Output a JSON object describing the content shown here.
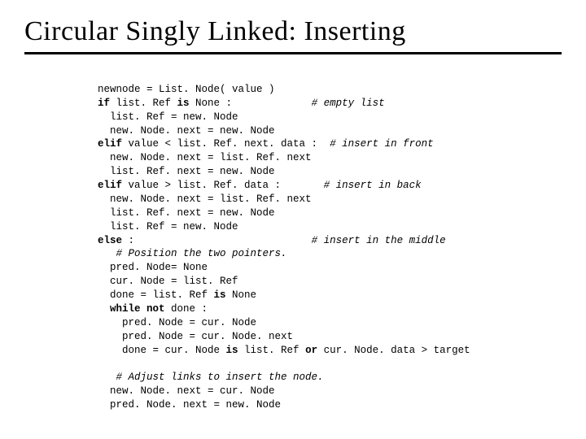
{
  "title": "Circular Singly Linked: Inserting",
  "code": {
    "l01a": "newnode = List. Node( value )",
    "l02a": "if",
    "l02b": " list. Ref ",
    "l02c": "is",
    "l02d": " None :             ",
    "l02e": "# empty list",
    "l03a": "  list. Ref = new. Node",
    "l04a": "  new. Node. next = new. Node",
    "l05a": "elif",
    "l05b": " value < list. Ref. next. data :  ",
    "l05c": "# insert in front",
    "l06a": "  new. Node. next = list. Ref. next",
    "l07a": "  list. Ref. next = new. Node",
    "l08a": "elif",
    "l08b": " value > list. Ref. data :       ",
    "l08c": "# insert in back",
    "l09a": "  new. Node. next = list. Ref. next",
    "l10a": "  list. Ref. next = new. Node",
    "l11a": "  list. Ref = new. Node",
    "l12a": "else",
    "l12b": " :                             ",
    "l12c": "# insert in the middle",
    "l13a": "   # Position the two pointers.",
    "l14a": "  pred. Node= None",
    "l15a": "  cur. Node = list. Ref",
    "l16a": "  done = list. Ref ",
    "l16b": "is",
    "l16c": " None",
    "l17a": "  ",
    "l17b": "while not",
    "l17c": " done :",
    "l18a": "    pred. Node = cur. Node",
    "l19a": "    pred. Node = cur. Node. next",
    "l20a": "    done = cur. Node ",
    "l20b": "is",
    "l20c": " list. Ref ",
    "l20d": "or",
    "l20e": " cur. Node. data > target",
    "blank": "",
    "l21a": "   # Adjust links to insert the node.",
    "l22a": "  new. Node. next = cur. Node",
    "l23a": "  pred. Node. next = new. Node"
  }
}
